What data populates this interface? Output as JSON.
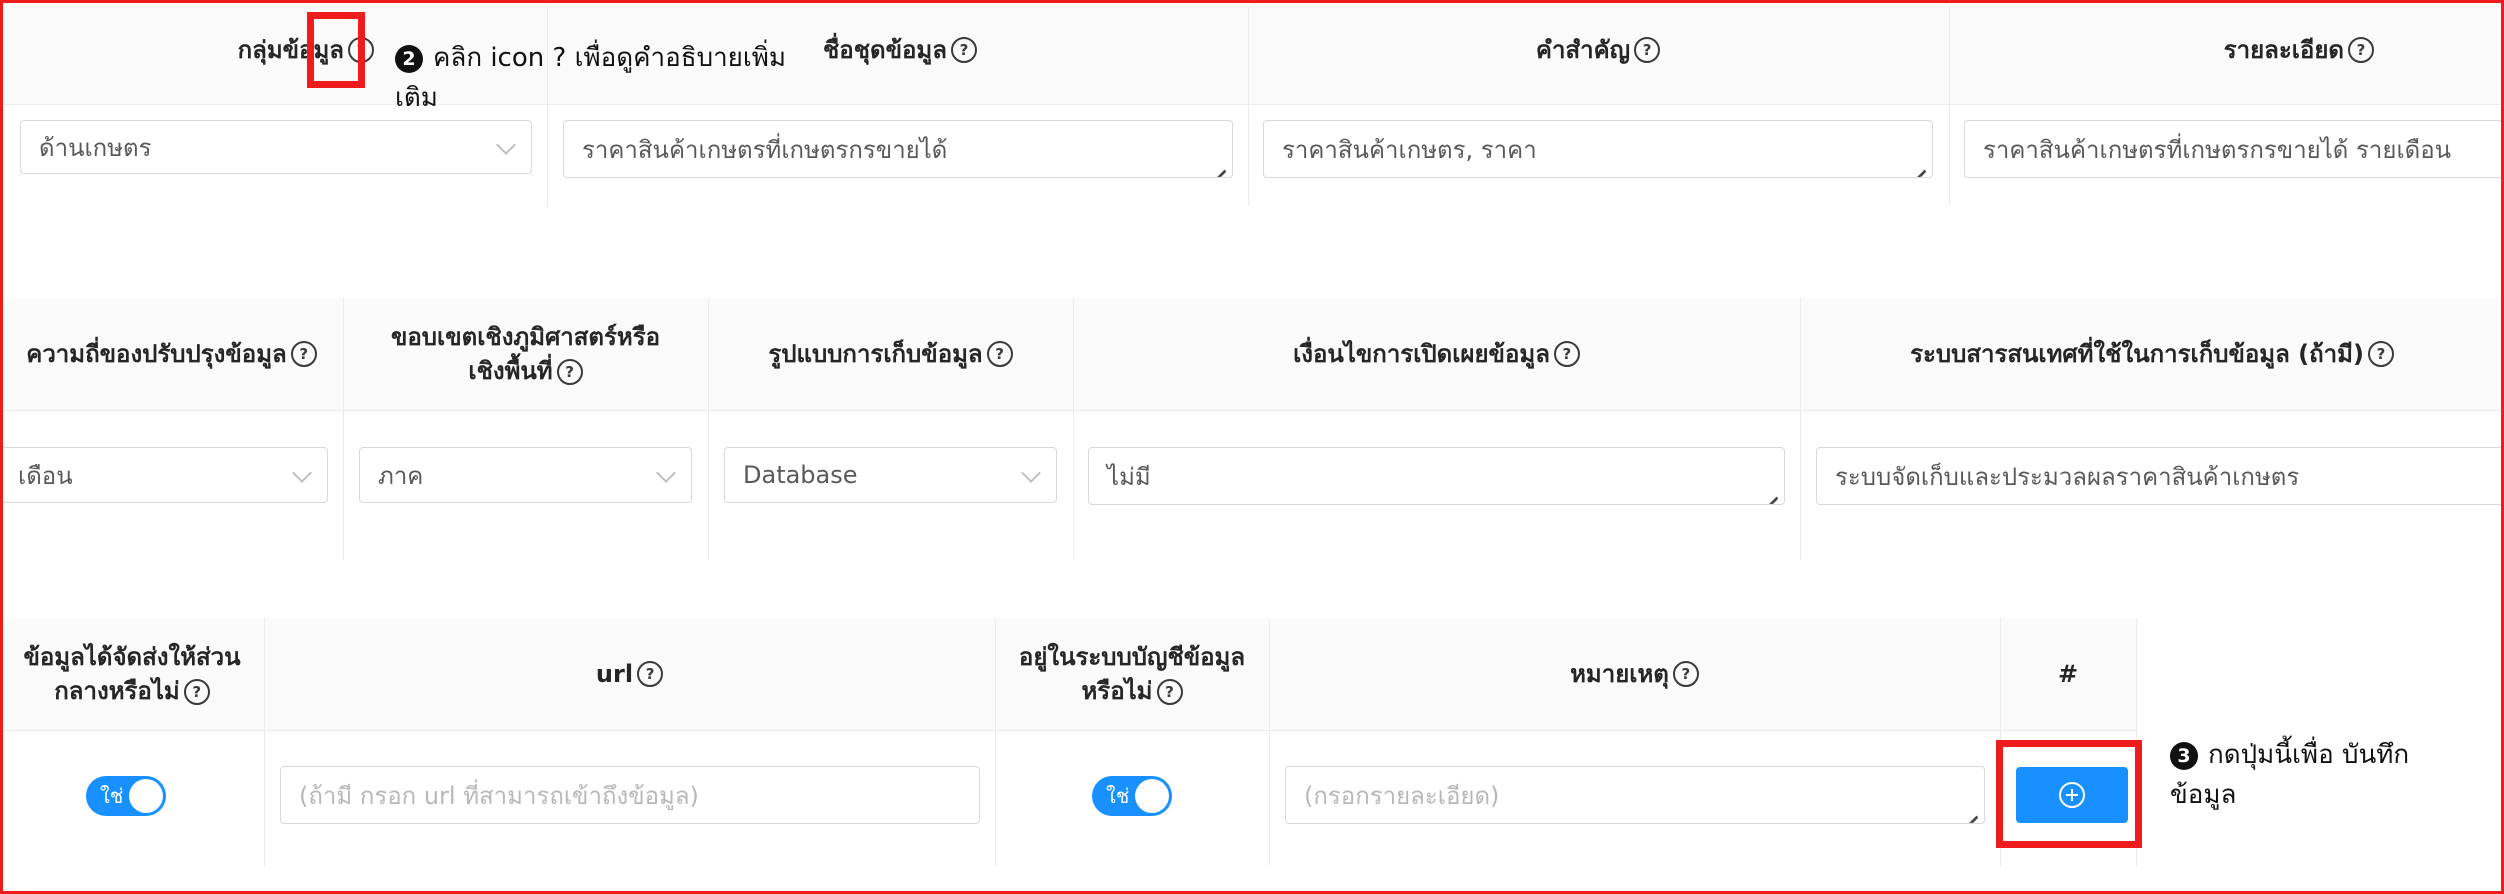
{
  "row1": {
    "headers": [
      {
        "label": "กลุ่มข้อมูล"
      },
      {
        "label": "ชื่อชุดข้อมูล"
      },
      {
        "label": "คำสำคัญ"
      },
      {
        "label": "รายละเอียด"
      }
    ],
    "group_select": "ด้านเกษตร",
    "dataset_name": "ราคาสินค้าเกษตรที่เกษตรกรขายได้",
    "keywords": "ราคาสินค้าเกษตร, ราคา",
    "details": "ราคาสินค้าเกษตรที่เกษตรกรขายได้ รายเดือน"
  },
  "row2": {
    "headers": [
      {
        "label": "ความถี่ของปรับปรุงข้อมูล"
      },
      {
        "label": "ขอบเขตเชิงภูมิศาสตร์หรือเชิงพื้นที่"
      },
      {
        "label": "รูปแบบการเก็บข้อมูล"
      },
      {
        "label": "เงื่อนไขการเปิดเผยข้อมูล"
      },
      {
        "label": "ระบบสารสนเทศที่ใช้ในการเก็บข้อมูล (ถ้ามี)"
      }
    ],
    "frequency": "เดือน",
    "geo_scope": "ภาค",
    "storage_format": "Database",
    "disclosure": "ไม่มี",
    "info_system": "ระบบจัดเก็บและประมวลผลราคาสินค้าเกษตร"
  },
  "row3": {
    "headers": [
      {
        "label": "ข้อมูลได้จัดส่งให้ส่วนกลางหรือไม่"
      },
      {
        "label": "url"
      },
      {
        "label": "อยู่ในระบบบัญชีข้อมูลหรือไม่"
      },
      {
        "label": "หมายเหตุ"
      },
      {
        "label": "#"
      }
    ],
    "sent_toggle": "ใช่",
    "url_placeholder": "(ถ้ามี กรอก url ที่สามารถเข้าถึงข้อมูล)",
    "catalog_toggle": "ใช่",
    "note_placeholder": "(กรอกรายละเอียด)"
  },
  "annotations": {
    "step2_num": "2",
    "step2": "คลิก icon ? เพื่อดูคำอธิบายเพิ่มเติม",
    "step3_num": "3",
    "step3": "กดปุ่มนี้เพื่อ บันทึกข้อมูล"
  },
  "icons": {
    "help": "question-circle-icon",
    "add": "plus-circle-icon"
  },
  "colors": {
    "primary": "#1890ff",
    "annotation_red": "#ee1c1c"
  }
}
